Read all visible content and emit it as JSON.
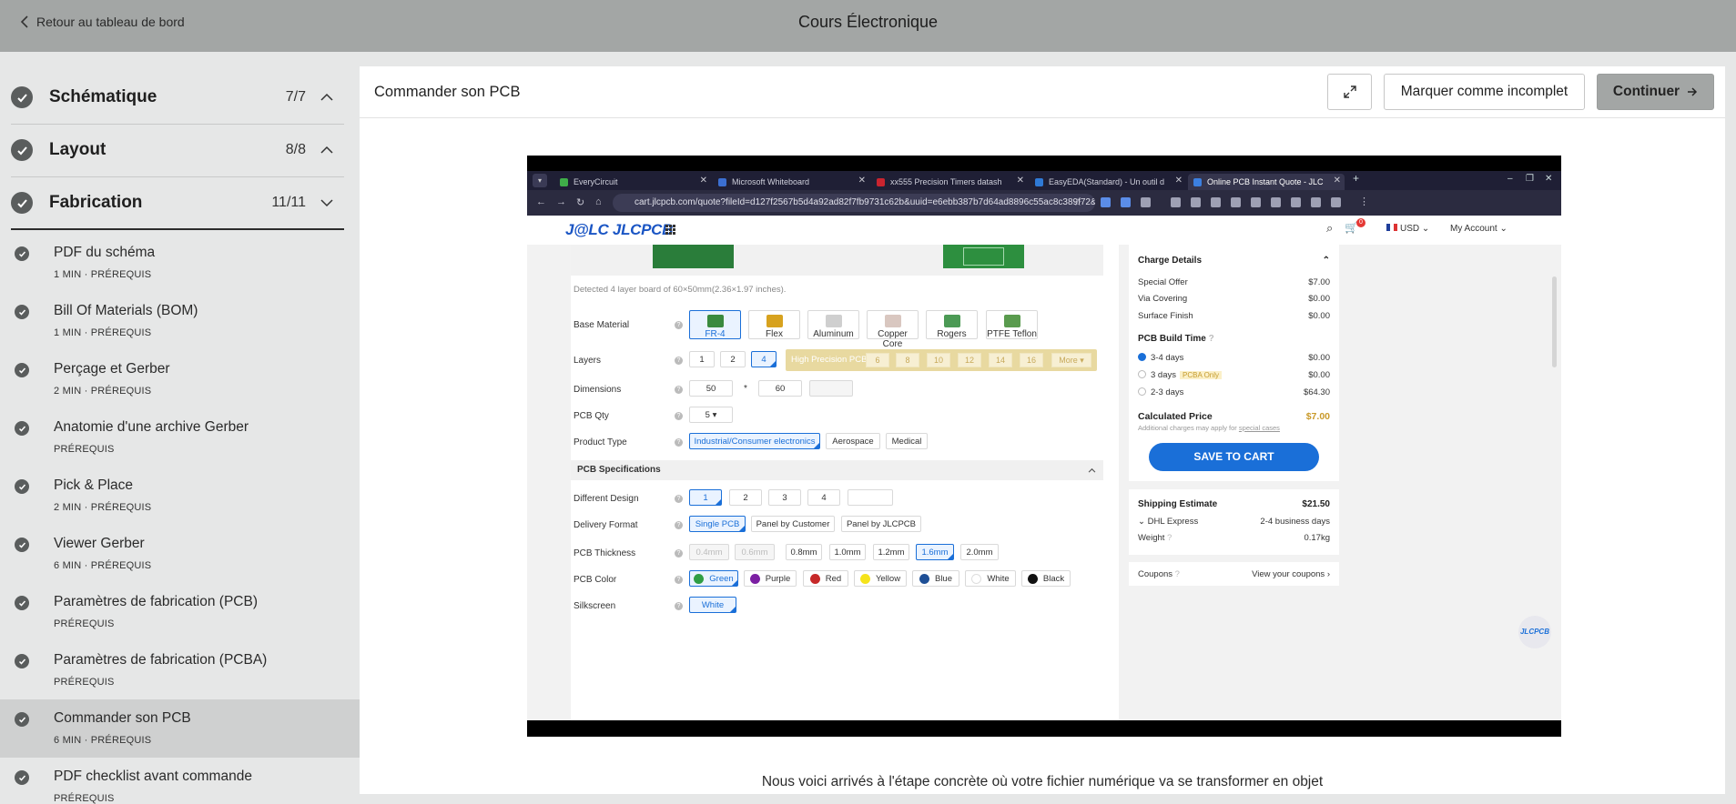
{
  "topbar": {
    "back_label": "Retour au tableau de bord",
    "course_title": "Cours Électronique"
  },
  "sidebar": {
    "sections": [
      {
        "title": "Schématique",
        "count": "7/7",
        "expanded": false
      },
      {
        "title": "Layout",
        "count": "8/8",
        "expanded": false
      },
      {
        "title": "Fabrication",
        "count": "11/11",
        "expanded": true
      }
    ],
    "lessons": [
      {
        "title": "PDF du schéma",
        "duration": "1 MIN",
        "tag": "PRÉREQUIS",
        "active": false
      },
      {
        "title": "Bill Of Materials (BOM)",
        "duration": "1 MIN",
        "tag": "PRÉREQUIS",
        "active": false
      },
      {
        "title": "Perçage et Gerber",
        "duration": "2 MIN",
        "tag": "PRÉREQUIS",
        "active": false
      },
      {
        "title": "Anatomie d'une archive Gerber",
        "duration": "",
        "tag": "PRÉREQUIS",
        "active": false
      },
      {
        "title": "Pick & Place",
        "duration": "2 MIN",
        "tag": "PRÉREQUIS",
        "active": false
      },
      {
        "title": "Viewer Gerber",
        "duration": "6 MIN",
        "tag": "PRÉREQUIS",
        "active": false
      },
      {
        "title": "Paramètres de fabrication (PCB)",
        "duration": "",
        "tag": "PRÉREQUIS",
        "active": false
      },
      {
        "title": "Paramètres de fabrication (PCBA)",
        "duration": "",
        "tag": "PRÉREQUIS",
        "active": false
      },
      {
        "title": "Commander son PCB",
        "duration": "6 MIN",
        "tag": "PRÉREQUIS",
        "active": true
      },
      {
        "title": "PDF checklist avant commande",
        "duration": "",
        "tag": "PRÉREQUIS",
        "active": false
      }
    ]
  },
  "main": {
    "lesson_title": "Commander son PCB",
    "incomplete_label": "Marquer comme incomplet",
    "continue_label": "Continuer",
    "caption": "Nous voici arrivés à l'étape concrète où votre fichier numérique va se transformer en objet"
  },
  "video": {
    "tabs": [
      {
        "label": "EveryCircuit",
        "color": "#3fae49"
      },
      {
        "label": "Microsoft Whiteboard",
        "color": "#3b6fd1"
      },
      {
        "label": "xx555 Precision Timers datash",
        "color": "#c9242f"
      },
      {
        "label": "EasyEDA(Standard) - Un outil d",
        "color": "#2f7ad6"
      },
      {
        "label": "Online PCB Instant Quote - JLC",
        "color": "#3c80e0"
      }
    ],
    "url": "cart.jlcpcb.com/quote?fileId=d127f2567b5d4a92ad82f7fb9731c62b&uuid=e6ebb387b7d64ad8896c55ac8c389f72&achieve...",
    "site": {
      "logo": "J@LC JLCPCB",
      "cart_count": "0",
      "currency": "USD",
      "account": "My Account"
    },
    "detected": "Detected 4 layer board of 60×50mm(2.36×1.97 inches).",
    "form": {
      "base_material_label": "Base Material",
      "materials": [
        "FR-4",
        "Flex",
        "Aluminum",
        "Copper Core",
        "Rogers",
        "PTFE Teflon"
      ],
      "layers_label": "Layers",
      "layers": [
        "1",
        "2",
        "4"
      ],
      "high_precision_label": "High Precision PCB",
      "hp_layers": [
        "6",
        "8",
        "10",
        "12",
        "14",
        "16"
      ],
      "more_label": "More",
      "dimensions_label": "Dimensions",
      "dim_w": "50",
      "dim_h": "60",
      "dim_sep": "*",
      "qty_label": "PCB Qty",
      "qty": "5",
      "product_type_label": "Product Type",
      "product_types": [
        "Industrial/Consumer electronics",
        "Aerospace",
        "Medical"
      ],
      "spec_title": "PCB Specifications",
      "diff_design_label": "Different Design",
      "diff_designs": [
        "1",
        "2",
        "3",
        "4"
      ],
      "delivery_label": "Delivery Format",
      "delivery": [
        "Single PCB",
        "Panel by Customer",
        "Panel by JLCPCB"
      ],
      "thickness_label": "PCB Thickness",
      "thickness": [
        "0.4mm",
        "0.6mm",
        "0.8mm",
        "1.0mm",
        "1.2mm",
        "1.6mm",
        "2.0mm"
      ],
      "color_label": "PCB Color",
      "colors": [
        {
          "name": "Green",
          "hex": "#2f9e44"
        },
        {
          "name": "Purple",
          "hex": "#7b1fa2"
        },
        {
          "name": "Red",
          "hex": "#c62828"
        },
        {
          "name": "Yellow",
          "hex": "#f5e31b"
        },
        {
          "name": "Blue",
          "hex": "#1e4f96"
        },
        {
          "name": "White",
          "hex": "#ffffff"
        },
        {
          "name": "Black",
          "hex": "#111111"
        }
      ],
      "silkscreen_label": "Silkscreen",
      "silkscreen": "White"
    },
    "charges": {
      "title": "Charge Details",
      "rows": [
        {
          "label": "Special Offer",
          "value": "$7.00"
        },
        {
          "label": "Via Covering",
          "value": "$0.00"
        },
        {
          "label": "Surface Finish",
          "value": "$0.00"
        }
      ],
      "build_time_title": "PCB Build Time",
      "build_times": [
        {
          "label": "3-4 days",
          "value": "$0.00",
          "selected": true,
          "badge": ""
        },
        {
          "label": "3 days",
          "value": "$0.00",
          "selected": false,
          "badge": "PCBA Only"
        },
        {
          "label": "2-3 days",
          "value": "$64.30",
          "selected": false,
          "badge": ""
        }
      ],
      "calc_label": "Calculated Price",
      "calc_value": "$7.00",
      "calc_note_prefix": "Additional charges may apply for ",
      "calc_note_link": "special cases",
      "save_label": "SAVE TO CART"
    },
    "shipping": {
      "title": "Shipping Estimate",
      "value": "$21.50",
      "method": "DHL Express",
      "method_days": "2-4 business days",
      "weight_label": "Weight",
      "weight": "0.17kg"
    },
    "coupons": {
      "label": "Coupons",
      "link": "View your coupons"
    },
    "fab_label": "JLCPCB"
  }
}
